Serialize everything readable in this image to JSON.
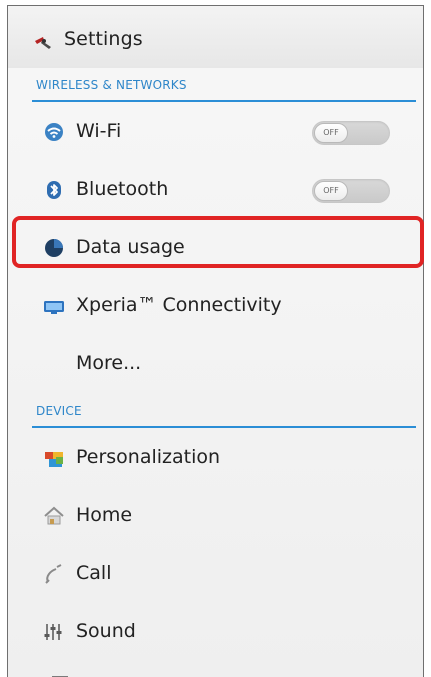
{
  "header": {
    "title": "Settings",
    "icon": "settings-icon"
  },
  "sections": {
    "wireless": "WIRELESS & NETWORKS",
    "device": "DEVICE"
  },
  "items": {
    "wifi": {
      "label": "Wi-Fi",
      "icon": "wifi-icon",
      "toggle_state": "OFF"
    },
    "bluetooth": {
      "label": "Bluetooth",
      "icon": "bluetooth-icon",
      "toggle_state": "OFF"
    },
    "data_usage": {
      "label": "Data usage",
      "icon": "data-usage-icon",
      "highlighted": true
    },
    "xperia": {
      "label": "Xperia™ Connectivity",
      "icon": "xperia-connectivity-icon"
    },
    "more": {
      "label": "More..."
    },
    "personalization": {
      "label": "Personalization",
      "icon": "personalization-icon"
    },
    "home": {
      "label": "Home",
      "icon": "home-icon"
    },
    "call": {
      "label": "Call",
      "icon": "call-icon"
    },
    "sound": {
      "label": "Sound",
      "icon": "sound-icon"
    }
  },
  "colors": {
    "section_header": "#2e86c9",
    "section_line": "#2b8ed6",
    "highlight": "#e02424"
  }
}
